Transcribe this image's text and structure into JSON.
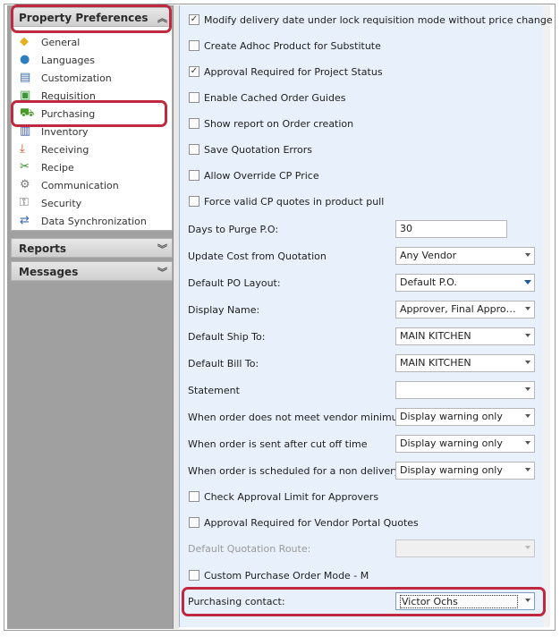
{
  "nav": {
    "groups": [
      {
        "label": "Property Preferences",
        "expanded": true
      },
      {
        "label": "Reports",
        "expanded": false
      },
      {
        "label": "Messages",
        "expanded": false
      }
    ],
    "items": [
      {
        "label": "General",
        "icon": "general-icon"
      },
      {
        "label": "Languages",
        "icon": "globe-icon"
      },
      {
        "label": "Customization",
        "icon": "customization-icon"
      },
      {
        "label": "Requisition",
        "icon": "requisition-icon"
      },
      {
        "label": "Purchasing",
        "icon": "cart-icon",
        "selected": true
      },
      {
        "label": "Inventory",
        "icon": "inventory-icon"
      },
      {
        "label": "Receiving",
        "icon": "receiving-icon"
      },
      {
        "label": "Recipe",
        "icon": "recipe-icon"
      },
      {
        "label": "Communication",
        "icon": "communication-icon"
      },
      {
        "label": "Security",
        "icon": "lock-icon"
      },
      {
        "label": "Data Synchronization",
        "icon": "sync-icon"
      }
    ]
  },
  "purchasing": {
    "checks_top": [
      {
        "label": "Modify delivery date under lock requisition mode without price change",
        "checked": true
      },
      {
        "label": "Create Adhoc Product for Substitute",
        "checked": false
      },
      {
        "label": "Approval Required for Project Status",
        "checked": true
      },
      {
        "label": "Enable Cached Order Guides",
        "checked": false
      },
      {
        "label": "Show report on Order creation",
        "checked": false
      },
      {
        "label": "Save Quotation Errors",
        "checked": false
      },
      {
        "label": "Allow Override CP Price",
        "checked": false
      },
      {
        "label": "Force valid CP quotes in product pull",
        "checked": false
      }
    ],
    "fields": [
      {
        "label": "Days to Purge P.O:",
        "value": "30",
        "kind": "text"
      },
      {
        "label": "Update Cost from Quotation",
        "value": "Any Vendor",
        "kind": "select"
      },
      {
        "label": "Default PO Layout:",
        "value": "Default P.O.",
        "kind": "select-blue"
      },
      {
        "label": "Display Name:",
        "value": "Approver, Final Approver,...",
        "kind": "select"
      },
      {
        "label": "Default Ship To:",
        "value": "MAIN KITCHEN",
        "kind": "select"
      },
      {
        "label": "Default Bill To:",
        "value": "MAIN KITCHEN",
        "kind": "select"
      },
      {
        "label": "Statement",
        "value": "",
        "kind": "select"
      },
      {
        "label": "When order does not meet vendor minimum",
        "value": "Display warning only",
        "kind": "select"
      },
      {
        "label": "When order is sent after cut off time",
        "value": "Display warning only",
        "kind": "select"
      },
      {
        "label": "When order is scheduled for a non delivery day",
        "value": "Display warning only",
        "kind": "select"
      }
    ],
    "checks_bottom": [
      {
        "label": "Check Approval Limit for Approvers",
        "checked": false
      },
      {
        "label": "Approval Required for Vendor Portal Quotes",
        "checked": false
      }
    ],
    "quotation_route": {
      "label": "Default Quotation Route:",
      "value": ""
    },
    "custom_po_mode": {
      "label": "Custom Purchase Order Mode - M",
      "checked": false
    },
    "purchasing_contact": {
      "label": "Purchasing contact:",
      "value": "Victor Ochs"
    }
  },
  "colors": {
    "highlight": "#c0283f",
    "panel": "#e7f0fb"
  }
}
